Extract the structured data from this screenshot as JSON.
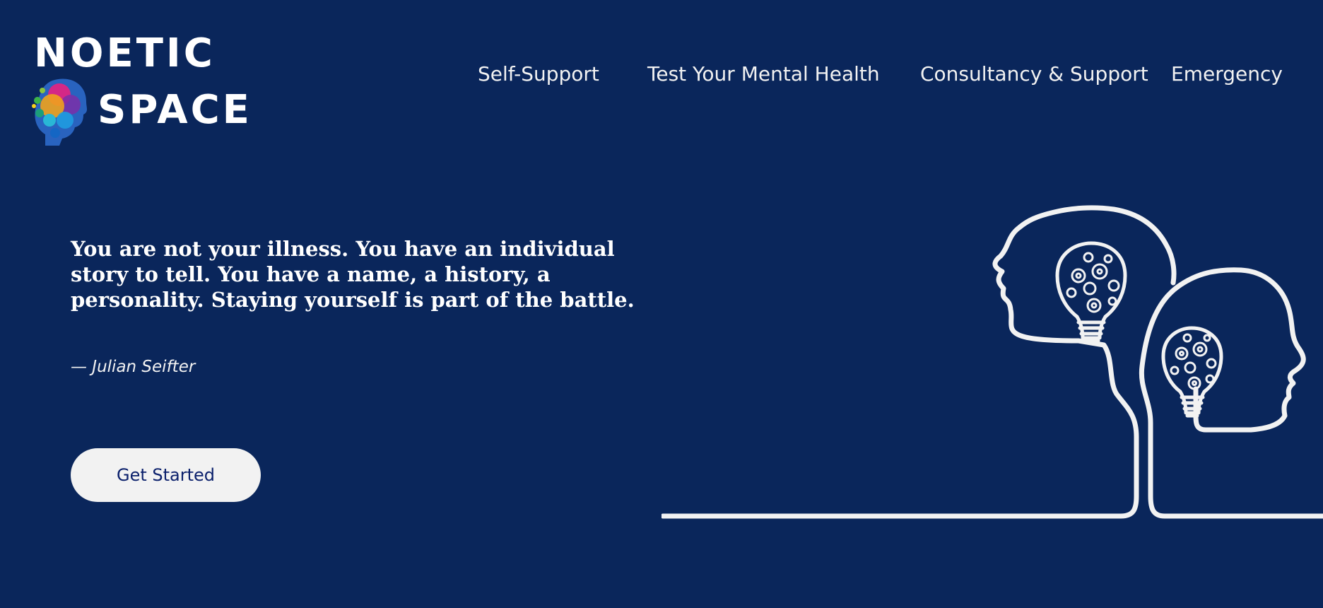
{
  "logo": {
    "line1": "NOETIC",
    "line2": "SPACE",
    "mark_icon": "colorful-head-icon"
  },
  "nav": {
    "items": [
      {
        "label": "Self-Support"
      },
      {
        "label": "Test Your Mental Health"
      },
      {
        "label": "Consultancy & Support"
      },
      {
        "label": "Emergency"
      }
    ]
  },
  "hero": {
    "quote": "You are not your illness. You have an individual story to tell. You have a name, a history, a personality. Staying yourself is part of the battle.",
    "author": "— Julian Seifter",
    "cta_label": "Get Started",
    "illustration_icon": "two-heads-lightbulb-gears-icon"
  },
  "colors": {
    "background": "#0a265b",
    "text": "#f2f2f2",
    "button_bg": "#f2f2f2",
    "button_text": "#0a1f6b"
  }
}
